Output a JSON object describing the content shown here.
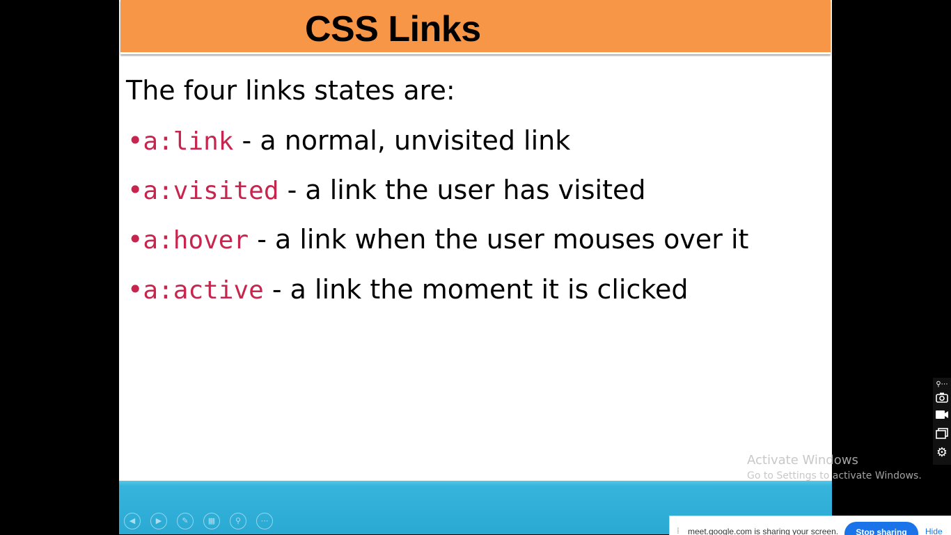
{
  "slide": {
    "title": "CSS Links",
    "intro": "The four links states are:",
    "bullets": [
      {
        "code": "a:link",
        "text": " - a normal, unvisited link"
      },
      {
        "code": "a:visited",
        "text": " - a link the user has visited"
      },
      {
        "code": "a:hover",
        "text": " - a link when the user mouses over it"
      },
      {
        "code": "a:active",
        "text": " - a link the moment it is clicked"
      }
    ],
    "bullet_char": "•"
  },
  "watermark": {
    "line1": "Activate Windows",
    "line2": "Go to Settings to activate Windows."
  },
  "share_bar": {
    "message": "meet.google.com is sharing your screen.",
    "stop_label": "Stop sharing",
    "hide_label": "Hide"
  },
  "side_tools": [
    "pin-icon",
    "camera-icon",
    "video-icon",
    "window-icon",
    "gear-icon"
  ],
  "slideshow_controls": [
    "previous-icon",
    "next-icon",
    "pen-icon",
    "slides-icon",
    "zoom-icon",
    "more-icon"
  ],
  "colors": {
    "title_bar": "#f79646",
    "code": "#c7254e",
    "bottom_bar": "#2aa9d3",
    "share_button": "#1a73e8"
  }
}
